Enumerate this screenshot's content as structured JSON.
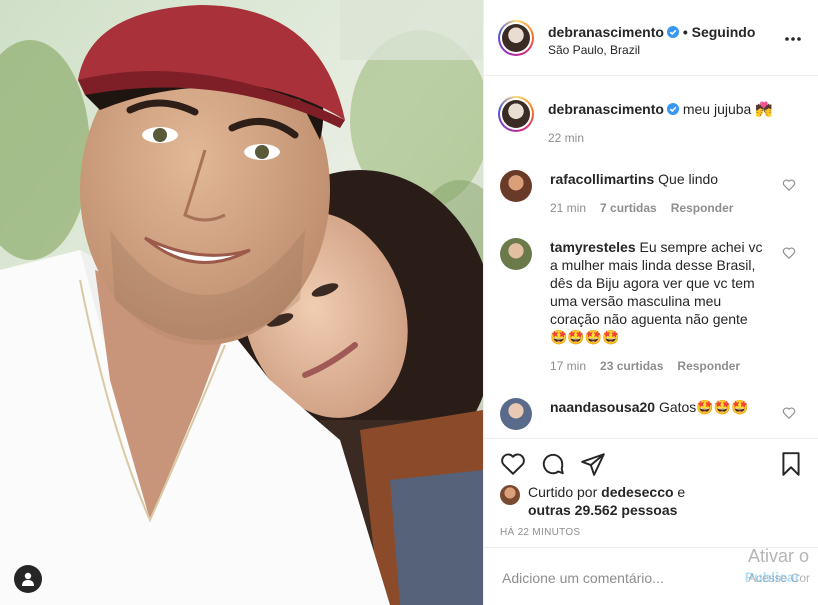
{
  "post": {
    "author": "debranascimento",
    "follow_status": "• Seguindo",
    "location": "São Paulo, Brazil",
    "caption": {
      "text": "meu jujuba 💏",
      "time": "22 min"
    }
  },
  "comments": [
    {
      "user": "rafacollimartins",
      "text": "Que lindo",
      "time": "21 min",
      "likes": "7 curtidas",
      "reply": "Responder"
    },
    {
      "user": "tamyresteles",
      "text": "Eu sempre achei vc a mulher mais linda desse Brasil, dês da Biju agora ver que vc tem uma versão masculina meu coração não aguenta não gente 🤩🤩🤩🤩",
      "time": "17 min",
      "likes": "23 curtidas",
      "reply": "Responder"
    },
    {
      "user": "naandasousa20",
      "text": "Gatos🤩🤩🤩",
      "time": "",
      "likes": "",
      "reply": ""
    }
  ],
  "likes": {
    "prefix": "Curtido por",
    "liker": "dedesecco",
    "middle": " e",
    "others": "outras 29.562 pessoas"
  },
  "timestamp": "HÁ 22 MINUTOS",
  "add_comment": {
    "placeholder": "Adicione um comentário...",
    "publish_label": "Publicar"
  },
  "overlay": {
    "line1": "Ativar o",
    "line2": "Acesse Cor"
  },
  "colors": {
    "verified": "#3897f0",
    "text": "#262626",
    "muted": "#8e8e8e",
    "publish_disabled": "#b2dffc"
  },
  "icons": [
    "user-tag-icon",
    "verified-icon",
    "more-options-icon",
    "heart-icon",
    "comment-icon",
    "share-icon",
    "bookmark-icon"
  ]
}
